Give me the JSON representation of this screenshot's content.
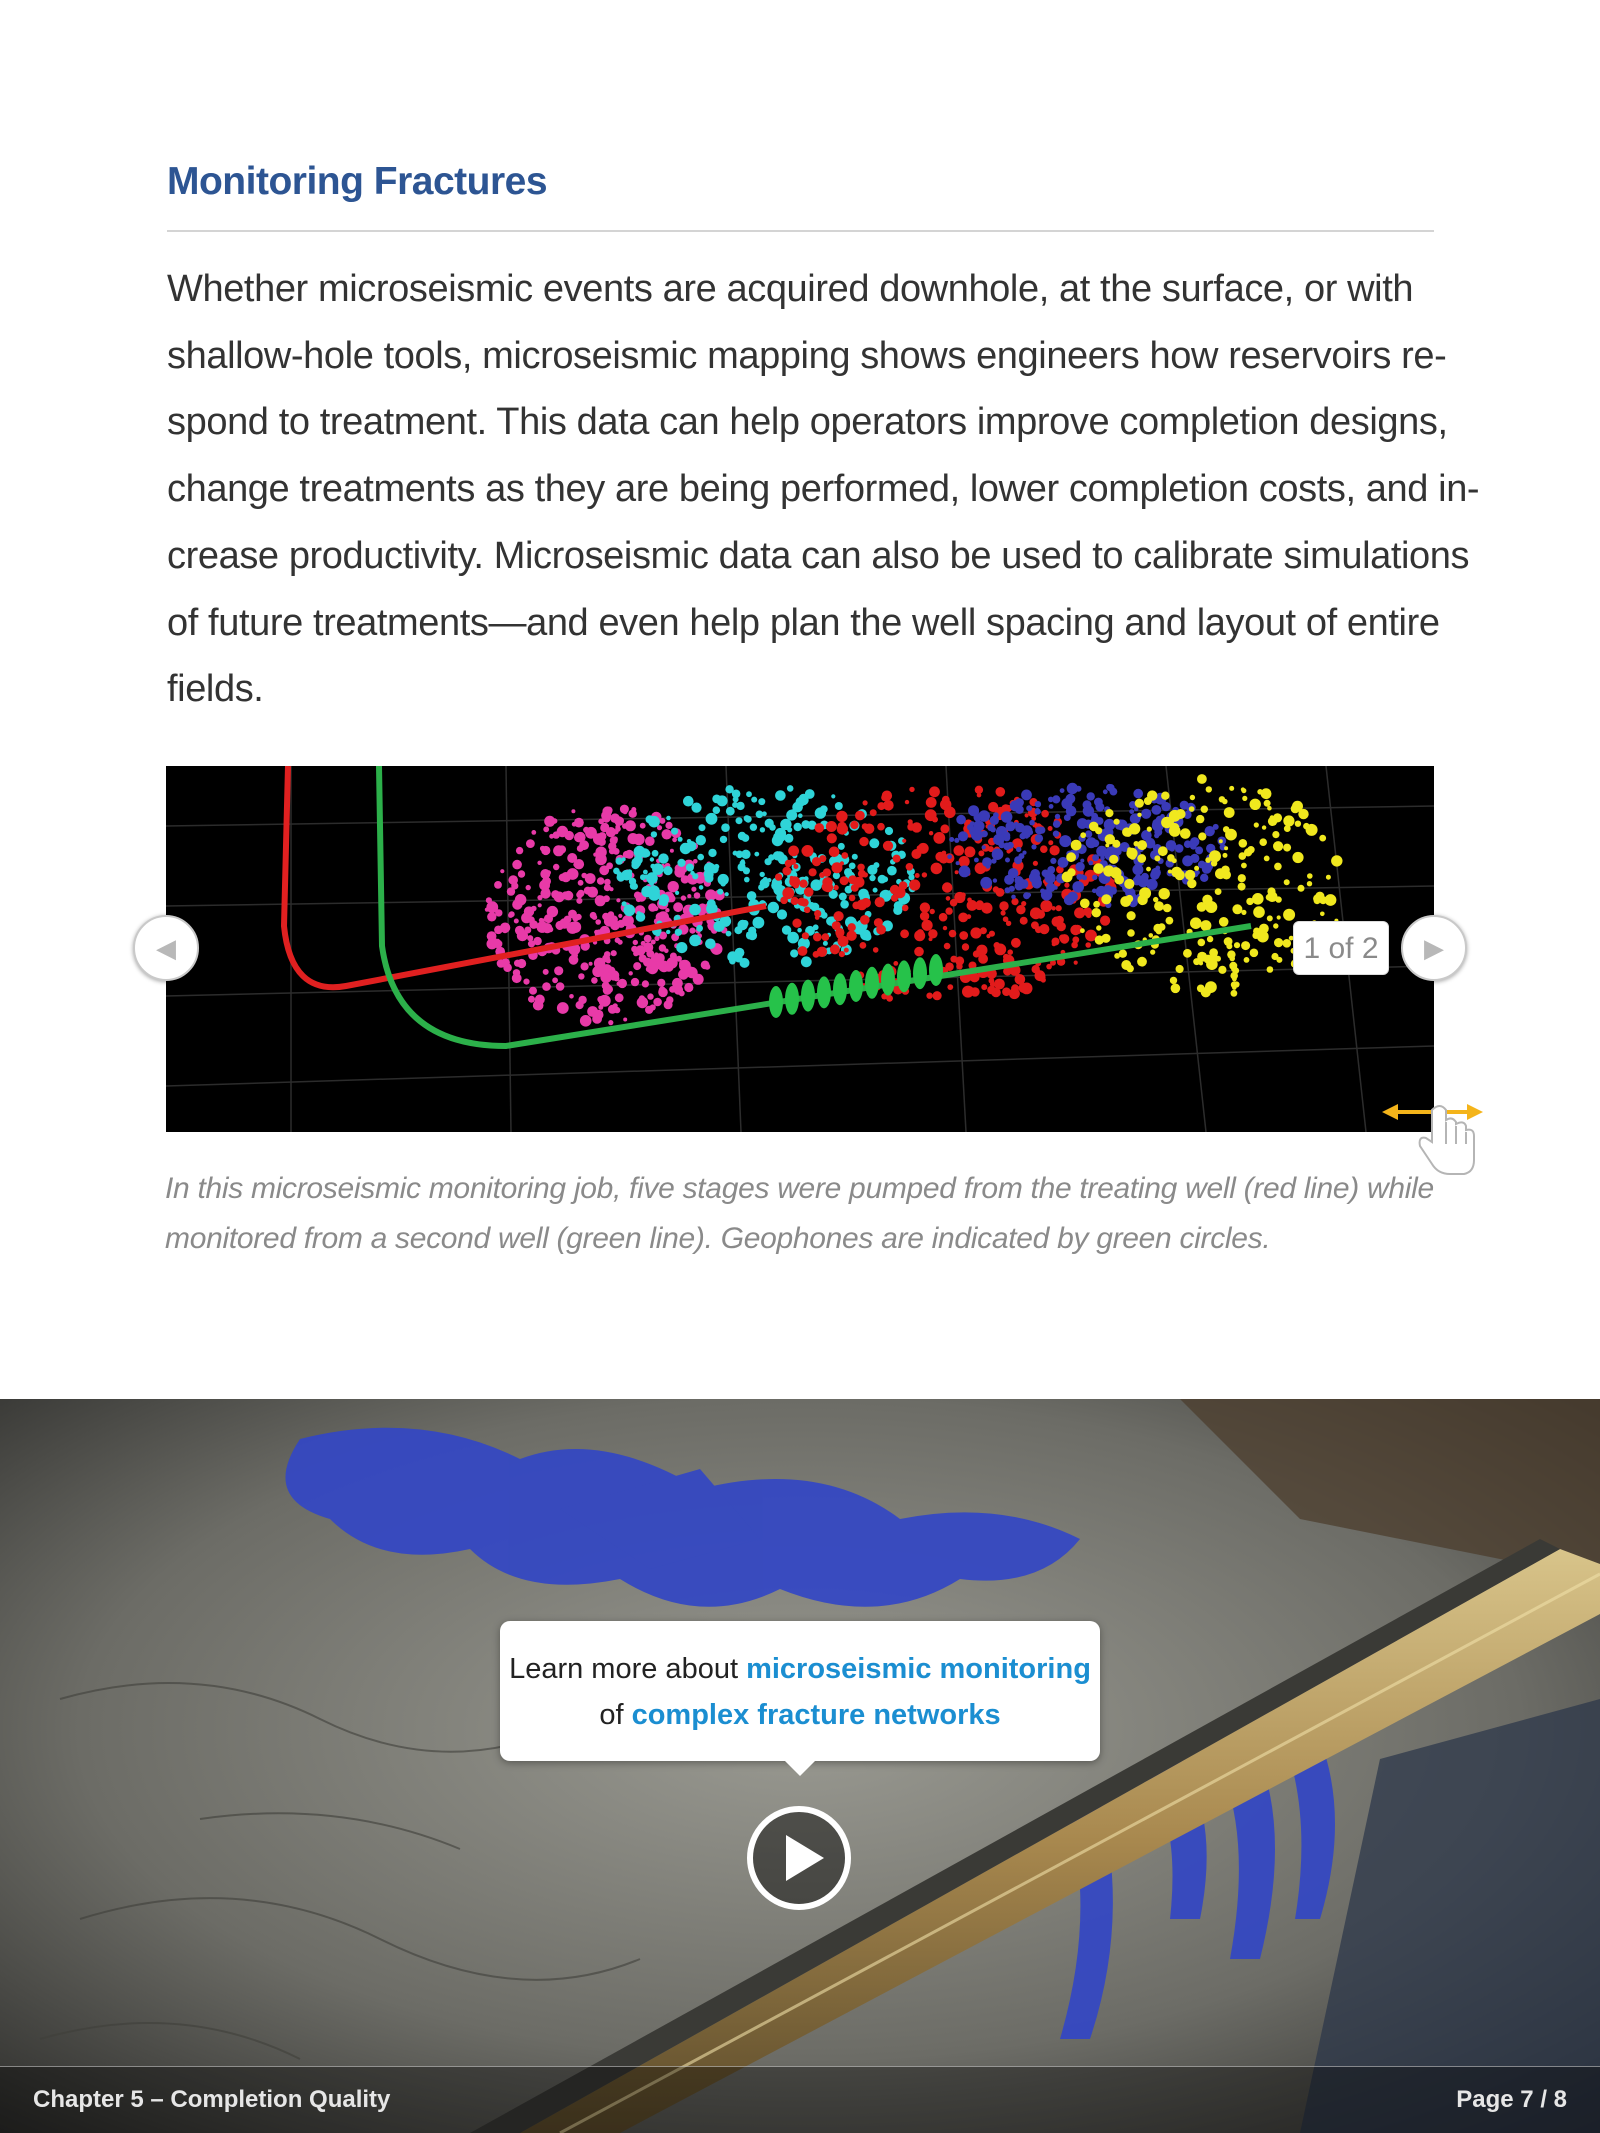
{
  "section": {
    "heading": "Monitoring Fractures",
    "body_lines": [
      "Whether microseismic events are acquired downhole, at the surface, or with",
      "shallow-hole tools, microseismic mapping shows engineers how reservoirs re-",
      "spond to treatment. This data can help operators improve completion designs,",
      "change treatments as they are being performed, lower completion costs, and in-",
      "crease productivity. Microseismic data can also be used to calibrate simulations",
      "of future treatments—and even help plan the well spacing and layout of entire",
      "fields."
    ]
  },
  "slideshow": {
    "prev_icon": "◀",
    "next_icon": "▶",
    "counter": "1 of 2",
    "swipe_icon": "hand-swipe-icon",
    "caption_lines": [
      "In this microseismic monitoring job, five stages were pumped from the treating well (red line) while",
      "monitored from a second well (green line). Geophones are indicated by green circles."
    ]
  },
  "video": {
    "callout_prefix": "Learn more about ",
    "link1": "microseismic monitoring",
    "callout_mid": "of ",
    "link2": "complex fracture networks",
    "play_icon": "play-icon"
  },
  "footer": {
    "chapter": "Chapter 5 – Completion Quality",
    "page": "Page 7 / 8"
  },
  "colors": {
    "heading": "#2d5593",
    "link": "#1b8ed1",
    "treating_well": "#e02020",
    "monitor_well": "#2cb04a",
    "stage_colors": [
      "#e83aa8",
      "#2fd4d8",
      "#e21b1b",
      "#3a3ab8",
      "#f0e81e"
    ]
  }
}
